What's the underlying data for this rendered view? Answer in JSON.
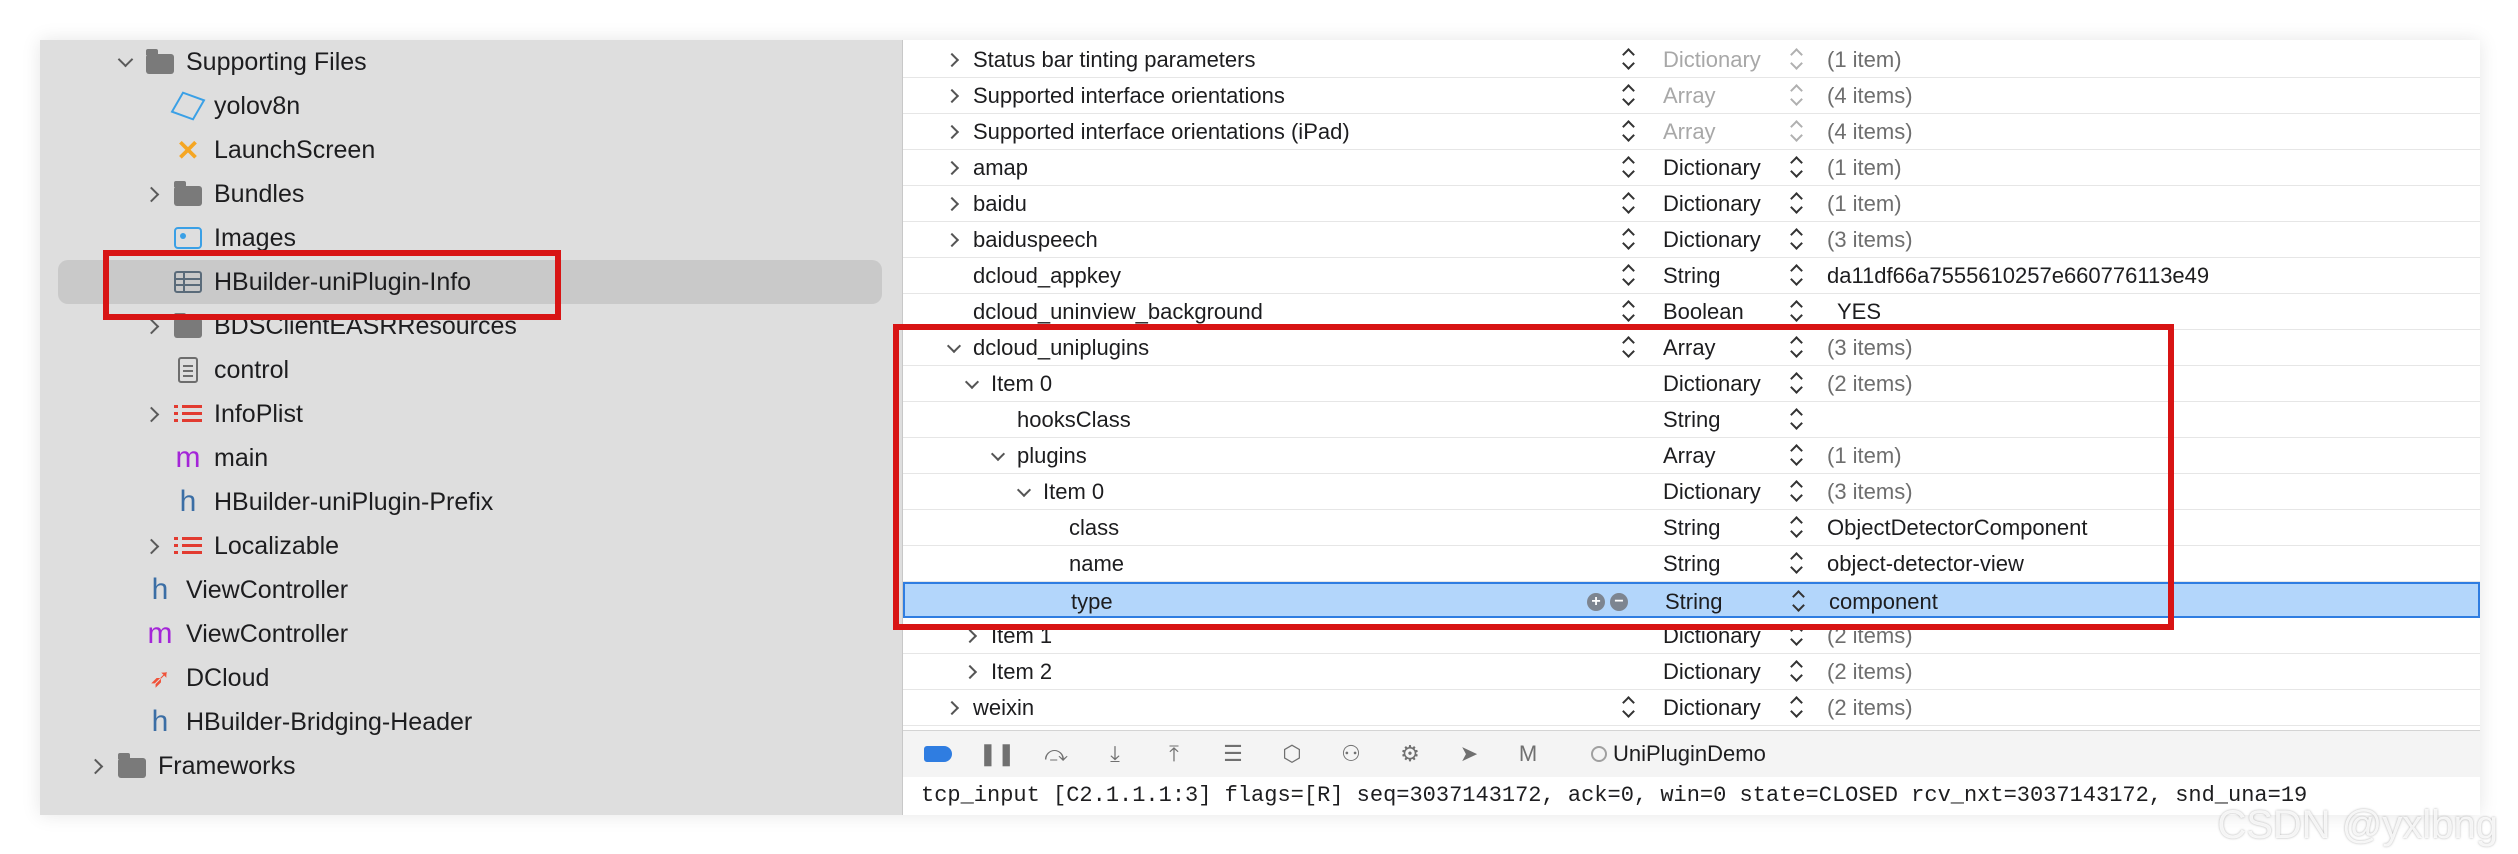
{
  "navigator": {
    "items": [
      {
        "label": "Supporting Files",
        "icon": "folder-icon",
        "chevron": "down",
        "depth": 2
      },
      {
        "label": "yolov8n",
        "icon": "mlmodel-icon",
        "chevron": "",
        "depth": 3
      },
      {
        "label": "LaunchScreen",
        "icon": "storyboard-icon",
        "chevron": "",
        "depth": 3
      },
      {
        "label": "Bundles",
        "icon": "folder-icon",
        "chevron": "right",
        "depth": 3
      },
      {
        "label": "Images",
        "icon": "asset-catalog-icon",
        "chevron": "",
        "depth": 3
      },
      {
        "label": "HBuilder-uniPlugin-Info",
        "icon": "plist-icon",
        "chevron": "",
        "depth": 3
      },
      {
        "label": "BDSClientEASRResources",
        "icon": "folder-icon",
        "chevron": "right",
        "depth": 3
      },
      {
        "label": "control",
        "icon": "text-file-icon",
        "chevron": "",
        "depth": 3
      },
      {
        "label": "InfoPlist",
        "icon": "strings-icon",
        "chevron": "right",
        "depth": 3
      },
      {
        "label": "main",
        "icon": "objc-m-icon",
        "chevron": "",
        "depth": 3
      },
      {
        "label": "HBuilder-uniPlugin-Prefix",
        "icon": "header-h-icon",
        "chevron": "",
        "depth": 3
      },
      {
        "label": "Localizable",
        "icon": "strings-icon",
        "chevron": "right",
        "depth": 3
      },
      {
        "label": "ViewController",
        "icon": "header-h-icon",
        "chevron": "",
        "depth": 2
      },
      {
        "label": "ViewController",
        "icon": "objc-m-icon",
        "chevron": "",
        "depth": 2
      },
      {
        "label": "DCloud",
        "icon": "swift-icon",
        "chevron": "",
        "depth": 2
      },
      {
        "label": "HBuilder-Bridging-Header",
        "icon": "header-h-icon",
        "chevron": "",
        "depth": 2
      },
      {
        "label": "Frameworks",
        "icon": "folder-icon",
        "chevron": "right",
        "depth": 1
      }
    ],
    "selected_index": 5
  },
  "plist": {
    "rows": [
      {
        "key": "Status bar tinting parameters",
        "type": "Dictionary",
        "value": "(1 item)",
        "chevron": "right",
        "depth": 0,
        "type_dim": true,
        "value_dim": true,
        "key_sort": true
      },
      {
        "key": "Supported interface orientations",
        "type": "Array",
        "value": "(4 items)",
        "chevron": "right",
        "depth": 0,
        "type_dim": true,
        "value_dim": true,
        "key_sort": true
      },
      {
        "key": "Supported interface orientations (iPad)",
        "type": "Array",
        "value": "(4 items)",
        "chevron": "right",
        "depth": 0,
        "type_dim": true,
        "value_dim": true,
        "key_sort": true
      },
      {
        "key": "amap",
        "type": "Dictionary",
        "value": "(1 item)",
        "chevron": "right",
        "depth": 0,
        "type_dim": false,
        "value_dim": true,
        "key_sort": true
      },
      {
        "key": "baidu",
        "type": "Dictionary",
        "value": "(1 item)",
        "chevron": "right",
        "depth": 0,
        "type_dim": false,
        "value_dim": true,
        "key_sort": true
      },
      {
        "key": "baiduspeech",
        "type": "Dictionary",
        "value": "(3 items)",
        "chevron": "right",
        "depth": 0,
        "type_dim": false,
        "value_dim": true,
        "key_sort": true
      },
      {
        "key": "dcloud_appkey",
        "type": "String",
        "value": "da11df66a7555610257e660776113e49",
        "chevron": "",
        "depth": 0,
        "type_dim": false,
        "value_dim": false,
        "key_sort": true
      },
      {
        "key": "dcloud_uninview_background",
        "type": "Boolean",
        "value": "YES",
        "chevron": "",
        "depth": 0,
        "type_dim": false,
        "value_dim": false,
        "key_sort": true
      },
      {
        "key": "dcloud_uniplugins",
        "type": "Array",
        "value": "(3 items)",
        "chevron": "down",
        "depth": 0,
        "type_dim": false,
        "value_dim": true,
        "key_sort": true
      },
      {
        "key": "Item 0",
        "type": "Dictionary",
        "value": "(2 items)",
        "chevron": "down",
        "depth": 1,
        "type_dim": false,
        "value_dim": true,
        "key_sort": false
      },
      {
        "key": "hooksClass",
        "type": "String",
        "value": "",
        "chevron": "",
        "depth": 2,
        "type_dim": false,
        "value_dim": false,
        "key_sort": false
      },
      {
        "key": "plugins",
        "type": "Array",
        "value": "(1 item)",
        "chevron": "down",
        "depth": 2,
        "type_dim": false,
        "value_dim": true,
        "key_sort": false
      },
      {
        "key": "Item 0",
        "type": "Dictionary",
        "value": "(3 items)",
        "chevron": "down",
        "depth": 3,
        "type_dim": false,
        "value_dim": true,
        "key_sort": false
      },
      {
        "key": "class",
        "type": "String",
        "value": "ObjectDetectorComponent",
        "chevron": "",
        "depth": 4,
        "type_dim": false,
        "value_dim": false,
        "key_sort": false
      },
      {
        "key": "name",
        "type": "String",
        "value": "object-detector-view",
        "chevron": "",
        "depth": 4,
        "type_dim": false,
        "value_dim": false,
        "key_sort": false
      },
      {
        "key": "type",
        "type": "String",
        "value": "component",
        "chevron": "",
        "depth": 4,
        "type_dim": false,
        "value_dim": false,
        "key_sort": false,
        "selected": true
      },
      {
        "key": "Item 1",
        "type": "Dictionary",
        "value": "(2 items)",
        "chevron": "right",
        "depth": 1,
        "type_dim": false,
        "value_dim": true,
        "key_sort": false
      },
      {
        "key": "Item 2",
        "type": "Dictionary",
        "value": "(2 items)",
        "chevron": "right",
        "depth": 1,
        "type_dim": false,
        "value_dim": true,
        "key_sort": false
      },
      {
        "key": "weixin",
        "type": "Dictionary",
        "value": "(2 items)",
        "chevron": "right",
        "depth": 0,
        "type_dim": false,
        "value_dim": true,
        "key_sort": true
      }
    ]
  },
  "debugbar": {
    "scheme_label": "UniPluginDemo",
    "buttons": [
      "breakpoints-toggle-icon",
      "pause-icon",
      "step-over-icon",
      "step-into-icon",
      "step-out-icon",
      "view-hierarchy-icon",
      "memory-graph-icon",
      "environment-icon",
      "simulate-location-icon",
      "location-arrow-icon",
      "metal-icon"
    ]
  },
  "console": {
    "line": "tcp_input [C2.1.1.1:3] flags=[R] seq=3037143172, ack=0, win=0 state=CLOSED rcv_nxt=3037143172, snd_una=19"
  },
  "watermark": "CSDN @yxlbng",
  "colors": {
    "annotation": "#d81414",
    "selection": "#b3d6fb",
    "accent": "#2f7de1"
  }
}
